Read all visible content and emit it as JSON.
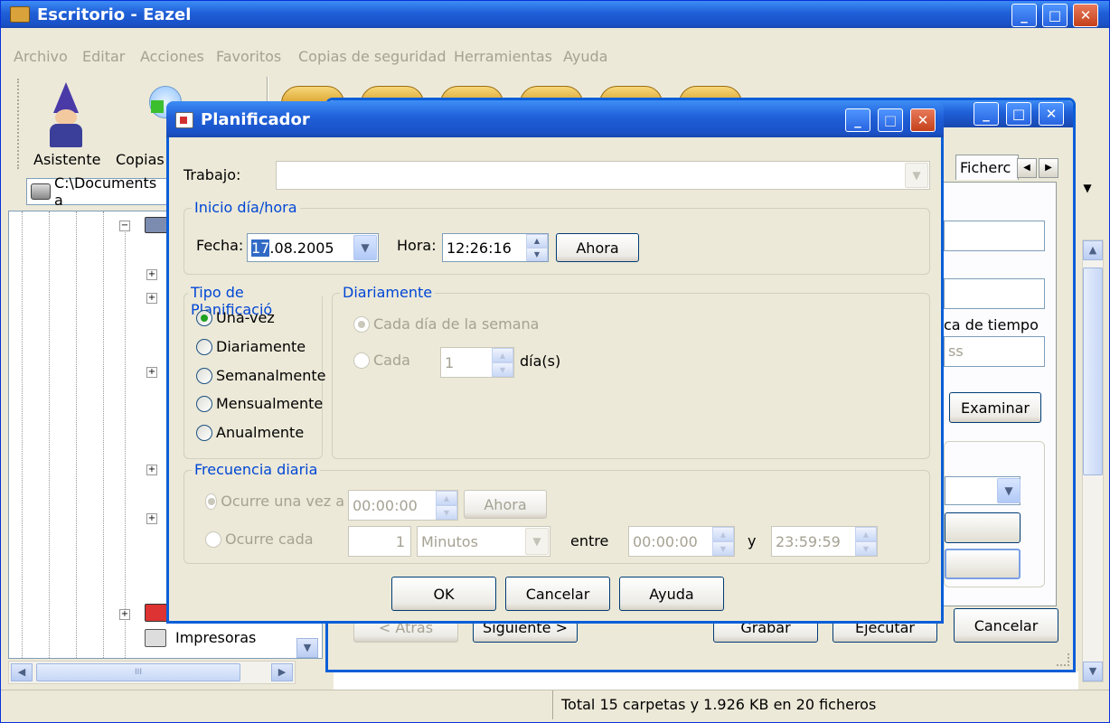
{
  "main_window": {
    "title": "Escritorio - Eazel",
    "menu": [
      "Archivo",
      "Editar",
      "Acciones",
      "Favoritos",
      "Copias de seguridad",
      "Herramientas",
      "Ayuda"
    ],
    "toolbar": {
      "wizard_label": "Asistente",
      "copies_label": "Copias"
    },
    "path": "C:\\Documents a",
    "tree_items": {
      "printers": "Impresoras",
      "hscroll_mid": "III"
    },
    "status_text": "Total 15 carpetas y 1.926 KB en 20 ficheros"
  },
  "second_window": {
    "tab_label": "Ficherc",
    "time_label": "ca de tiempo",
    "time_placeholder": "ss",
    "browse_button": "Examinar",
    "buttons": {
      "back": "< Atrás",
      "next": "Siguiente >",
      "save": "Grabar",
      "run": "Ejecutar",
      "cancel": "Cancelar"
    }
  },
  "dialog": {
    "title": "Planificador",
    "job_label": "Trabajo:",
    "job_value": "",
    "start_group": "Inicio día/hora",
    "date_label": "Fecha:",
    "date_sel": "17",
    "date_rest": ".08.2005",
    "time_label": "Hora:",
    "time_value": "12:26:16",
    "now_button": "Ahora",
    "type_group": "Tipo de Planificació",
    "types": [
      "Una-vez",
      "Diariamente",
      "Semanalmente",
      "Mensualmente",
      "Anualmente"
    ],
    "selected_type": "Una-vez",
    "daily_group": "Diariamente",
    "each_weekday": "Cada día de la semana",
    "each_label": "Cada",
    "each_value": "1",
    "days_unit": "día(s)",
    "freq_group": "Frecuencia diaria",
    "occurs_once": "Ocurre una vez a",
    "occurs_once_time": "00:00:00",
    "now_button_2": "Ahora",
    "occurs_every": "Ocurre cada",
    "every_value": "1",
    "every_unit": "Minutos",
    "between_label": "entre",
    "between_start": "00:00:00",
    "and_label": "y",
    "between_end": "23:59:59",
    "ok_button": "OK",
    "cancel_button": "Cancelar",
    "help_button": "Ayuda"
  }
}
